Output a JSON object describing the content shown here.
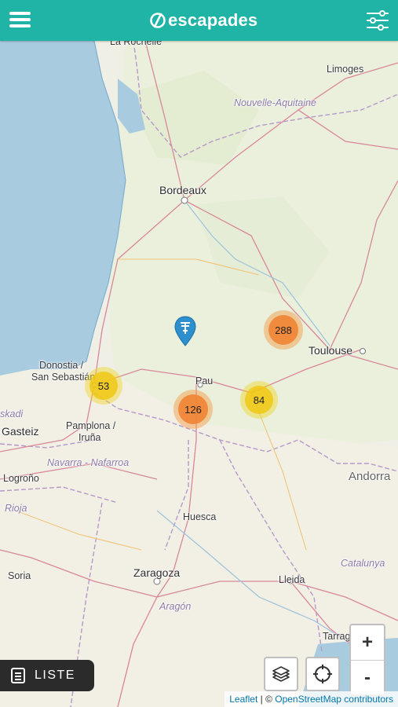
{
  "header": {
    "app_name": "escapades",
    "menu_icon": "hamburger-icon",
    "filter_icon": "sliders-icon",
    "brand_color": "#1fb4a6"
  },
  "map": {
    "places": [
      {
        "id": "la-rochelle",
        "label": "La Rochelle"
      },
      {
        "id": "limoges",
        "label": "Limoges"
      },
      {
        "id": "nouvelle-aquitaine",
        "label": "Nouvelle-Aquitaine"
      },
      {
        "id": "bordeaux",
        "label": "Bordeaux"
      },
      {
        "id": "toulouse",
        "label": "Toulouse"
      },
      {
        "id": "donostia",
        "label": "Donostia /"
      },
      {
        "id": "san-sebastian",
        "label": "San Sebastián"
      },
      {
        "id": "pau",
        "label": "Pau"
      },
      {
        "id": "euskadi",
        "label": "skadi"
      },
      {
        "id": "gasteiz",
        "label": "Gasteiz"
      },
      {
        "id": "pamplona",
        "label": "Pamplona /"
      },
      {
        "id": "iruna",
        "label": "Iruña"
      },
      {
        "id": "navarra",
        "label": "Navarra - Nafarroa"
      },
      {
        "id": "andorra",
        "label": "Andorra"
      },
      {
        "id": "logrono",
        "label": "Logroño"
      },
      {
        "id": "rioja",
        "label": "Rioja"
      },
      {
        "id": "huesca",
        "label": "Huesca"
      },
      {
        "id": "catalunya",
        "label": "Catalunya"
      },
      {
        "id": "soria",
        "label": "Soria"
      },
      {
        "id": "zaragoza",
        "label": "Zaragoza"
      },
      {
        "id": "lleida",
        "label": "Lleida"
      },
      {
        "id": "aragon",
        "label": "Aragón"
      },
      {
        "id": "tarragona",
        "label": "Tarrag"
      }
    ],
    "clusters": [
      {
        "id": "53",
        "count": "53",
        "color": "yellow"
      },
      {
        "id": "288",
        "count": "288",
        "color": "orange"
      },
      {
        "id": "126",
        "count": "126",
        "color": "orange"
      },
      {
        "id": "84",
        "count": "84",
        "color": "yellow"
      }
    ],
    "marker_icon": "location-pin-icon"
  },
  "controls": {
    "liste_label": "LISTE",
    "liste_icon": "list-icon",
    "layers_icon": "layers-icon",
    "locate_icon": "crosshair-icon",
    "zoom_in": "+",
    "zoom_out": "-"
  },
  "attribution": {
    "leaflet": "Leaflet",
    "separator": " | © ",
    "osm": "OpenStreetMap contributors"
  }
}
